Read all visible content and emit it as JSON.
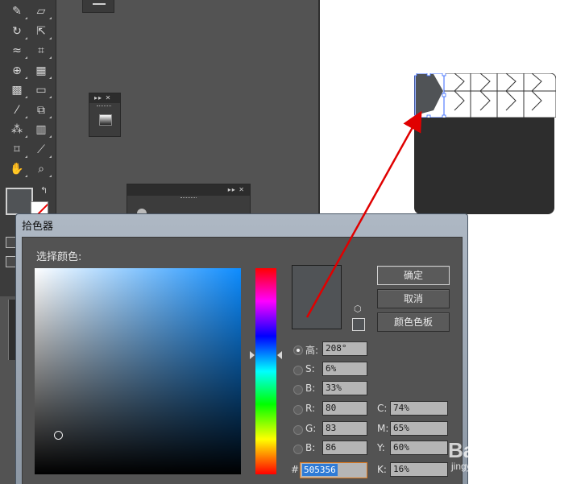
{
  "colors": {
    "current_color": "#505356",
    "selection_blue": "#2f7bd6",
    "hex_focus_border": "#e07a1e",
    "annotation_arrow": "#e00000"
  },
  "tools_panel": {
    "rows": [
      {
        "left": "paintbrush-icon",
        "right": "eraser-icon"
      },
      {
        "left": "rotate-icon",
        "right": "scale-icon"
      },
      {
        "left": "warp-icon",
        "right": "free-transform-icon"
      },
      {
        "left": "shape-builder-icon",
        "right": "perspective-grid-icon"
      },
      {
        "left": "mesh-icon",
        "right": "gradient-tool-icon"
      },
      {
        "left": "eyedropper-icon",
        "right": "blend-icon"
      },
      {
        "left": "symbol-sprayer-icon",
        "right": "column-graph-icon"
      },
      {
        "left": "artboard-icon",
        "right": "slice-icon"
      },
      {
        "left": "hand-icon",
        "right": "zoom-icon"
      }
    ]
  },
  "color_picker": {
    "title": "拾色器",
    "select_label": "选择颜色:",
    "buttons": {
      "ok": "确定",
      "cancel": "取消",
      "swatches": "颜色色板"
    },
    "hsb": [
      {
        "label": "高:",
        "value": "208°",
        "selected": true
      },
      {
        "label": "S:",
        "value": "6%",
        "selected": false
      },
      {
        "label": "B:",
        "value": "33%",
        "selected": false
      }
    ],
    "rgb": [
      {
        "label": "R:",
        "value": "80"
      },
      {
        "label": "G:",
        "value": "83"
      },
      {
        "label": "B:",
        "value": "86"
      }
    ],
    "cmyk": [
      {
        "label": "C:",
        "value": "74%"
      },
      {
        "label": "M:",
        "value": "65%"
      },
      {
        "label": "Y:",
        "value": "60%"
      },
      {
        "label": "K:",
        "value": "16%"
      }
    ],
    "hex_label": "#",
    "hex_value": "505356"
  },
  "watermark": {
    "logo_text": "Bai  经验",
    "url": "jingyan.baidu.com"
  }
}
